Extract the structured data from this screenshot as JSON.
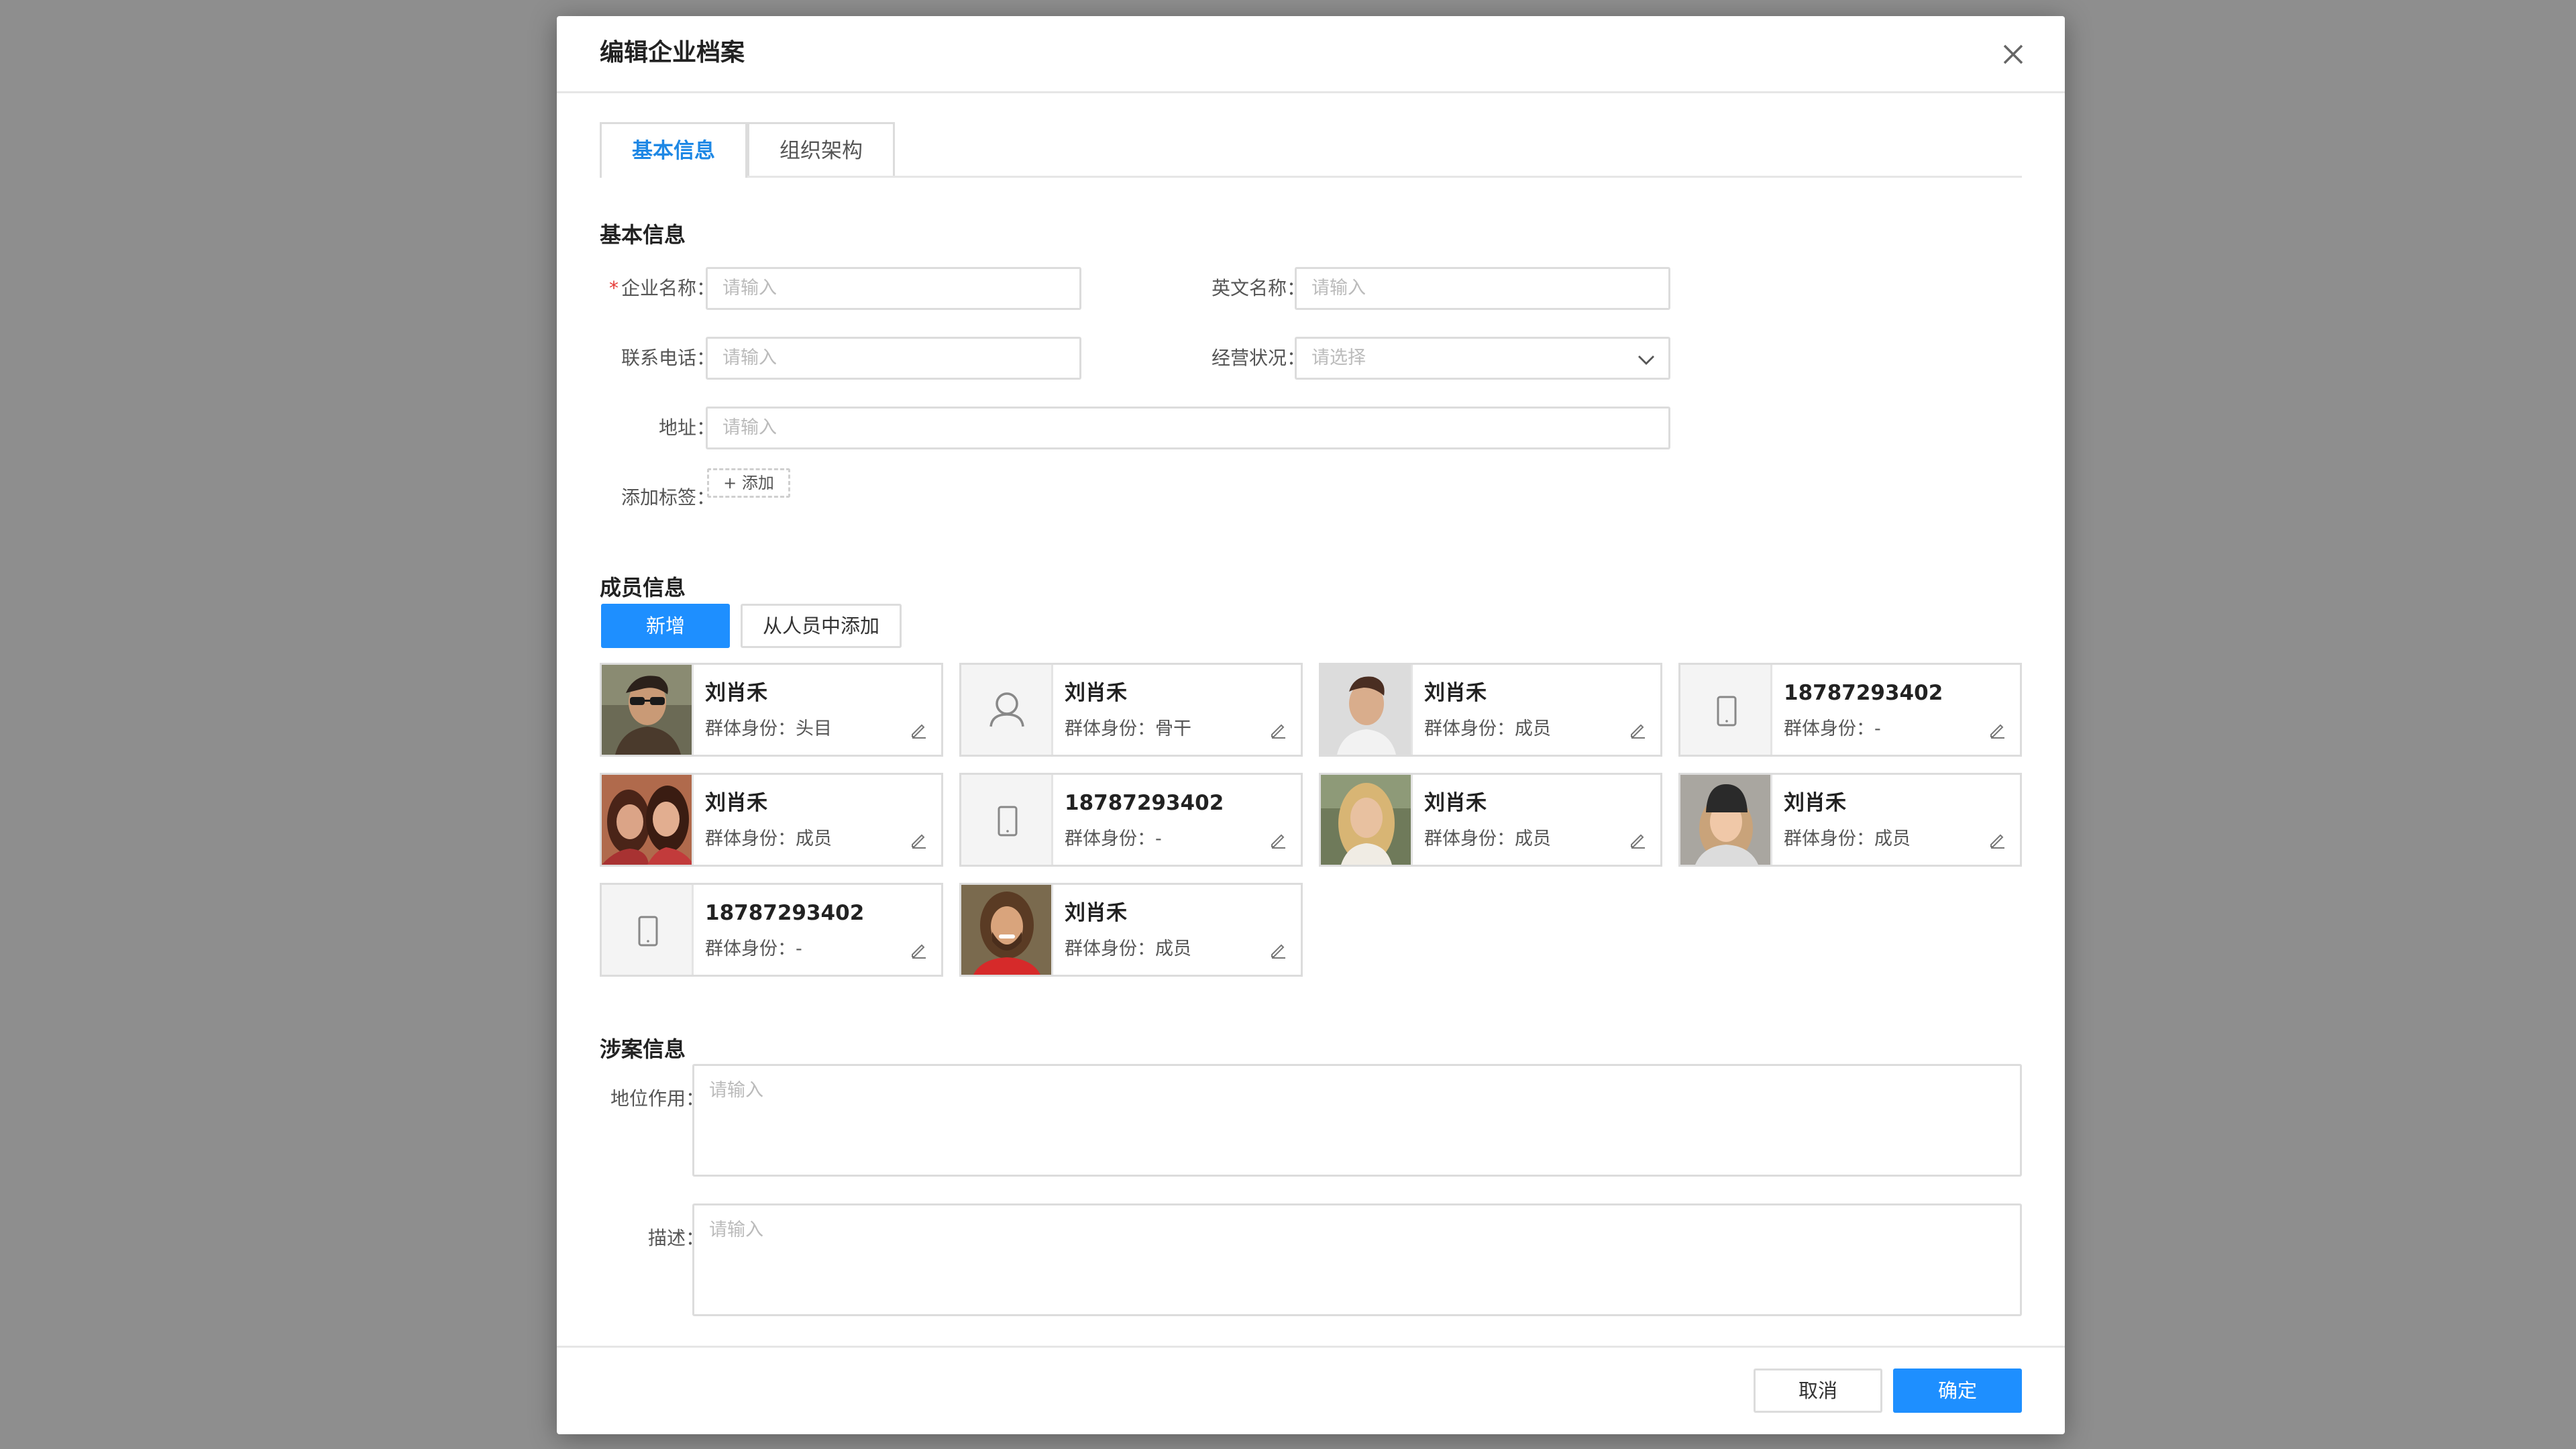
{
  "dialog": {
    "title": "编辑企业档案"
  },
  "tabs": [
    {
      "label": "基本信息"
    },
    {
      "label": "组织架构"
    }
  ],
  "basic": {
    "section_title": "基本信息",
    "company_name": {
      "label": "企业名称：",
      "required_mark": "*",
      "placeholder": "请输入"
    },
    "english_name": {
      "label": "英文名称：",
      "placeholder": "请输入"
    },
    "phone": {
      "label": "联系电话：",
      "placeholder": "请输入"
    },
    "status": {
      "label": "经营状况：",
      "placeholder": "请选择"
    },
    "address": {
      "label": "地址：",
      "placeholder": "请输入"
    },
    "tags": {
      "label": "添加标签：",
      "add_label": "+ 添加"
    }
  },
  "members": {
    "section_title": "成员信息",
    "add_button": "新增",
    "add_from_staff_button": "从人员中添加",
    "list": [
      {
        "name": "刘肖禾",
        "role": "群体身份：头目",
        "avatar": "photo-man-sunglasses"
      },
      {
        "name": "刘肖禾",
        "role": "群体身份：骨干",
        "avatar": "user-icon"
      },
      {
        "name": "刘肖禾",
        "role": "群体身份：成员",
        "avatar": "photo-man"
      },
      {
        "name": "18787293402",
        "role": "群体身份：-",
        "avatar": "phone-icon"
      },
      {
        "name": "刘肖禾",
        "role": "群体身份：成员",
        "avatar": "photo-two-women"
      },
      {
        "name": "18787293402",
        "role": "群体身份：-",
        "avatar": "phone-icon"
      },
      {
        "name": "刘肖禾",
        "role": "群体身份：成员",
        "avatar": "photo-blonde-woman"
      },
      {
        "name": "刘肖禾",
        "role": "群体身份：成员",
        "avatar": "photo-woman-beanie"
      },
      {
        "name": "18787293402",
        "role": "群体身份：-",
        "avatar": "phone-icon"
      },
      {
        "name": "刘肖禾",
        "role": "群体身份：成员",
        "avatar": "photo-bearded-man"
      }
    ]
  },
  "case": {
    "section_title": "涉案信息",
    "role": {
      "label": "地位作用：",
      "placeholder": "请输入"
    },
    "description": {
      "label": "描述：",
      "placeholder": "请输入"
    }
  },
  "footer": {
    "cancel": "取消",
    "confirm": "确定"
  },
  "colors": {
    "primary": "#1e8fff",
    "required": "#e53935",
    "overlay": "#8e8e8e"
  }
}
